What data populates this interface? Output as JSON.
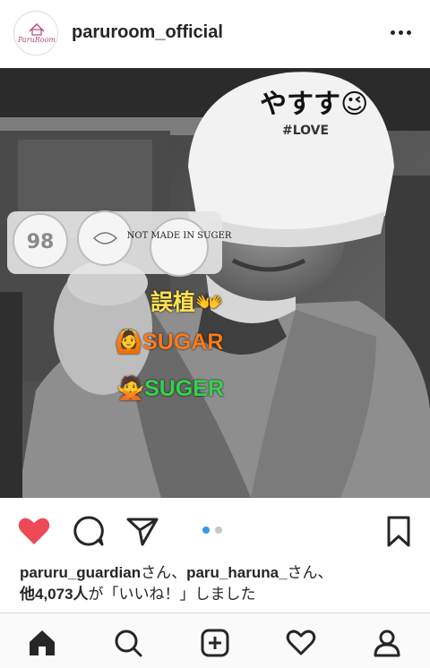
{
  "header": {
    "avatar_text": "ParuRoom",
    "username": "paruroom_official",
    "more_icon": "more-horizontal-icon"
  },
  "post": {
    "cap_text": "やすす😉",
    "cap_subtext": "#LOVE",
    "badge_texts": [
      "NOT MADE IN SUGER"
    ],
    "overlay_lines": [
      "誤植👐",
      "🙆SUGAR",
      "🙅SUGER"
    ],
    "overlay_colors": {
      "line1": "#ffe14d",
      "line2": "#ff7a1a",
      "line3": "#33d34d"
    }
  },
  "carousel": {
    "count": 2,
    "active_index": 0
  },
  "actions": {
    "like_icon": "heart-filled-icon",
    "comment_icon": "comment-icon",
    "share_icon": "paper-plane-icon",
    "save_icon": "bookmark-icon",
    "like_color": "#ed4956"
  },
  "likes": {
    "user1": "paruru_guardian",
    "sep1": "さん、",
    "user2": "paru_haruna_",
    "sep2": "さん、",
    "others": "他4,073人",
    "tail": "が「いいね！」しました"
  },
  "tabbar": {
    "items": [
      "home-icon",
      "search-icon",
      "add-post-icon",
      "activity-heart-icon",
      "profile-icon"
    ]
  }
}
